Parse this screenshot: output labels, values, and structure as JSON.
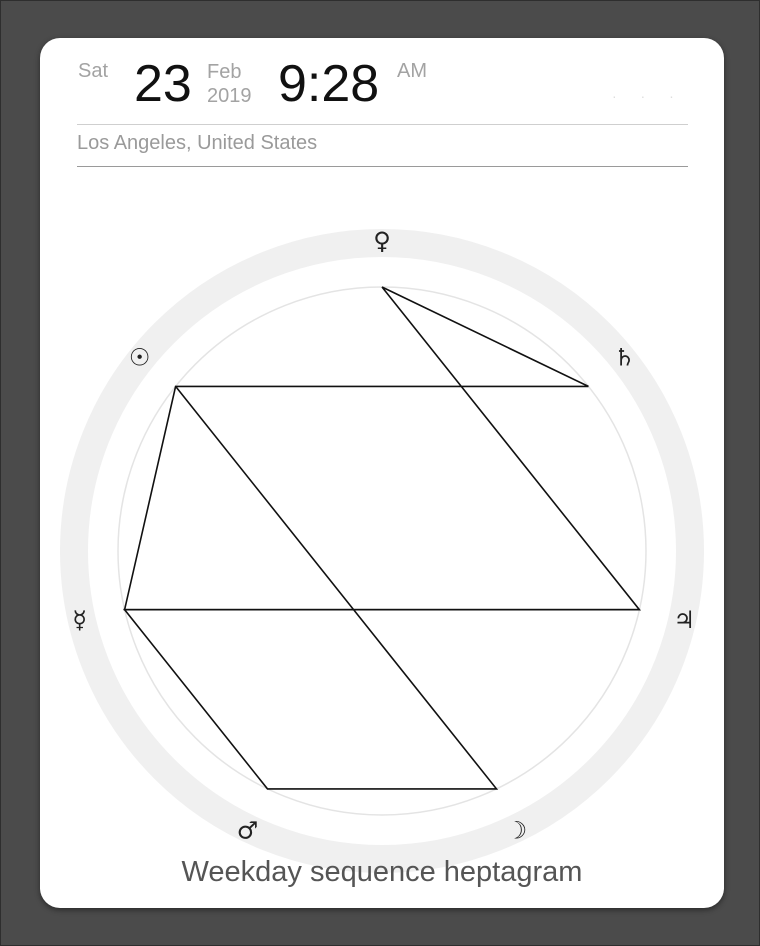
{
  "header": {
    "weekday": "Sat",
    "day": "23",
    "month": "Feb",
    "year": "2019",
    "time": "9:28",
    "ampm": "AM"
  },
  "location": {
    "value": "Los Angeles, United States"
  },
  "diagram": {
    "planets": [
      {
        "name": "venus",
        "symbol": "♀"
      },
      {
        "name": "saturn",
        "symbol": "♄"
      },
      {
        "name": "jupiter",
        "symbol": "♃"
      },
      {
        "name": "moon",
        "symbol": "☽"
      },
      {
        "name": "mars",
        "symbol": "♂"
      },
      {
        "name": "mercury",
        "symbol": "☿"
      },
      {
        "name": "sun",
        "symbol": "☉"
      }
    ],
    "sequence": [
      "venus",
      "jupiter",
      "mercury",
      "sun",
      "saturn",
      "venus"
    ],
    "sequence_two": [
      "jupiter",
      "mercury",
      "mars",
      "moon",
      "sun"
    ],
    "colors": {
      "ring": "#f0f0f0",
      "inner_circle": "#e4e4e4",
      "lines": "#111111",
      "symbols": "#222222"
    }
  },
  "caption": "Weekday sequence heptagram"
}
